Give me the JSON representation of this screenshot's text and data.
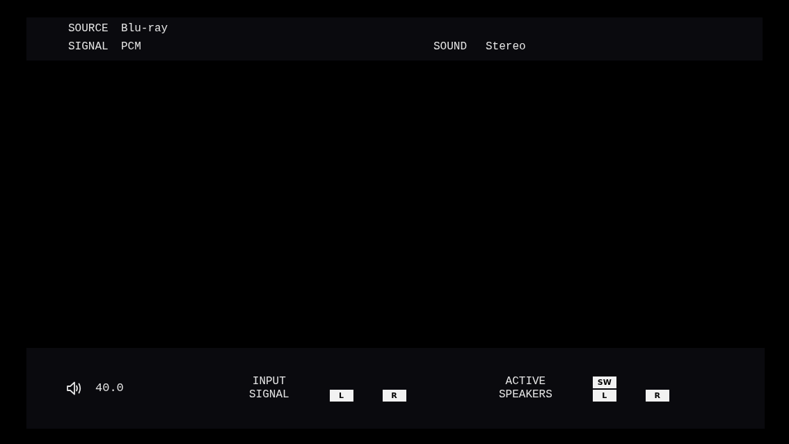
{
  "info": {
    "left": [
      {
        "label": "SOURCE",
        "value": "Blu-ray"
      },
      {
        "label": "SIGNAL",
        "value": "PCM"
      }
    ],
    "right": {
      "label": "SOUND",
      "value": "Stereo"
    }
  },
  "volume": {
    "value": "40.0"
  },
  "input_signal": {
    "label": "INPUT SIGNAL",
    "rows": [
      [
        {
          "label": "L",
          "active": true
        },
        {
          "label": "R",
          "active": true
        }
      ]
    ]
  },
  "active_speakers": {
    "label": "ACTIVE SPEAKERS",
    "rows": [
      [
        {
          "label": "SW",
          "active": true
        }
      ],
      [
        {
          "label": "L",
          "active": true
        },
        {
          "label": "R",
          "active": true
        }
      ]
    ]
  }
}
